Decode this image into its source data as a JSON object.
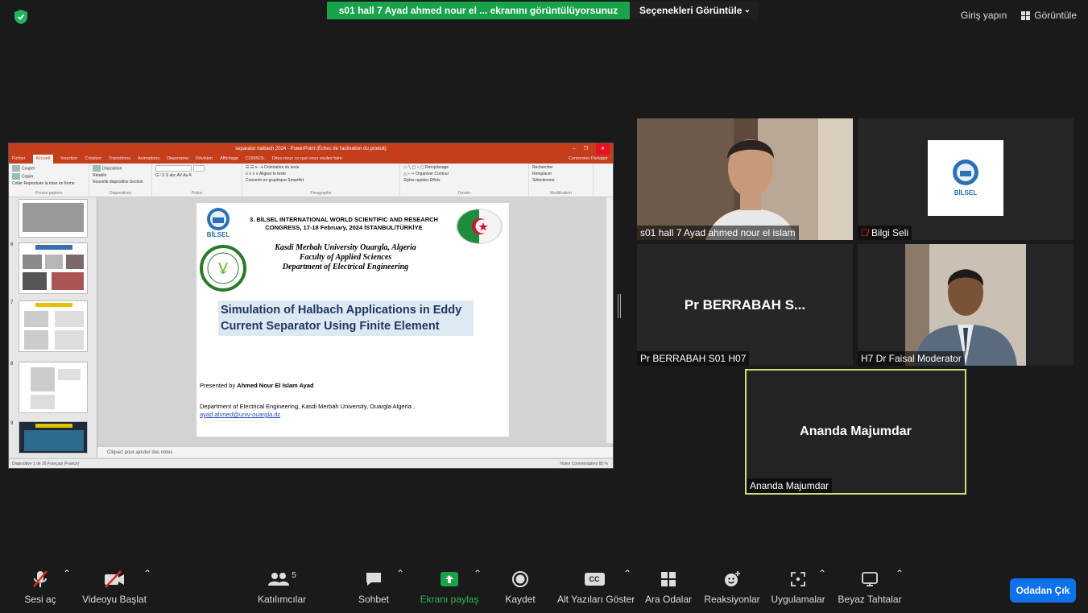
{
  "topbar": {
    "share_banner": "s01 hall 7 Ayad ahmed nour el ... ekranını görüntülüyorsunuz",
    "view_options": "Seçenekleri Görüntüle",
    "sign_in": "Giriş yapın",
    "view": "Görüntüle"
  },
  "ppt": {
    "window_title": "separator halbach 2024 - PowerPoint (Échec de l'activation du produit)",
    "tabs": [
      "Fichier",
      "Accueil",
      "Insertion",
      "Création",
      "Transitions",
      "Animations",
      "Diaporama",
      "Révision",
      "Affichage",
      "COMSOL",
      "Dites-nous ce que vous voulez faire"
    ],
    "tabs_right": [
      "Connexion",
      "Partager"
    ],
    "ribbon": {
      "clipboard": [
        "Couper",
        "Copier",
        "Reproduire la mise en forme",
        "Coller",
        "Presse-papiers"
      ],
      "slides": [
        "Disposition",
        "Rétablir",
        "Section",
        "Nouvelle diapositive",
        "Diapositives"
      ],
      "font": "Police",
      "paragraph": [
        "Orientation du texte",
        "Aligner le texte",
        "Convertir en graphique SmartArt",
        "Paragraphe"
      ],
      "drawing": [
        "Organiser",
        "Styles rapides",
        "Remplissage",
        "Contour",
        "Effets",
        "Dessin"
      ],
      "editing": [
        "Rechercher",
        "Remplacer",
        "Sélectionner",
        "Modification"
      ]
    },
    "thumb_numbers": [
      "6",
      "7",
      "8",
      "9"
    ],
    "notes_placeholder": "Cliquez pour ajouter des notes",
    "status_left": "Diapositive 1 de 26    Français (France)",
    "status_right": "Notes   Commentaires      85 %"
  },
  "slide": {
    "congress": "3. BİLSEL INTERNATIONAL WORLD SCIENTIFIC AND RESEARCH CONGRESS, 17-18 February, 2024 İSTANBUL/TÜRKİYE",
    "logo_text": "BİLSEL",
    "univ_lines": [
      "Kasdi Merbah University Ouargla, Algeria",
      "Faculty of Applied Sciences",
      "Department of Electrical Engineering"
    ],
    "title": "Simulation of Halbach Applications in Eddy Current Separator Using Finite Element",
    "presented_prefix": "Presented by",
    "presenter": "Ahmed Nour El Islam  Ayad",
    "dept_line": "Department of Electrical Engineering, Kasdi Merbah University, Ouargla Algeria ,",
    "email": "ayad.ahmed@univ-ouargla.dz"
  },
  "participants": [
    {
      "name": "s01 hall 7 Ayad ahmed nour el islam",
      "video": true
    },
    {
      "name": "Bilgi Seli",
      "muted": true,
      "logo": "BİLSEL"
    },
    {
      "name": "Pr BERRABAH  S01 H07",
      "display": "Pr BERRABAH  S..."
    },
    {
      "name": "H7 Dr Faisal Moderator",
      "video": true
    },
    {
      "name": "Ananda Majumdar",
      "display": "Ananda Majumdar",
      "active_speaker": true
    }
  ],
  "toolbar": {
    "unmute": "Sesi aç",
    "start_video": "Videoyu Başlat",
    "participants": "Katılımcılar",
    "participants_count": "5",
    "chat": "Sohbet",
    "share_screen": "Ekranı paylaş",
    "record": "Kaydet",
    "captions": "Alt Yazıları Göster",
    "breakout": "Ara Odalar",
    "reactions": "Reaksiyonlar",
    "apps": "Uygulamalar",
    "whiteboards": "Beyaz Tahtalar",
    "leave": "Odadan Çık",
    "cc": "CC"
  },
  "colors": {
    "share_green": "#18a24a",
    "leave_blue": "#0e72ed",
    "active_border": "#c4e37f",
    "ppt_red": "#c43e1c"
  }
}
